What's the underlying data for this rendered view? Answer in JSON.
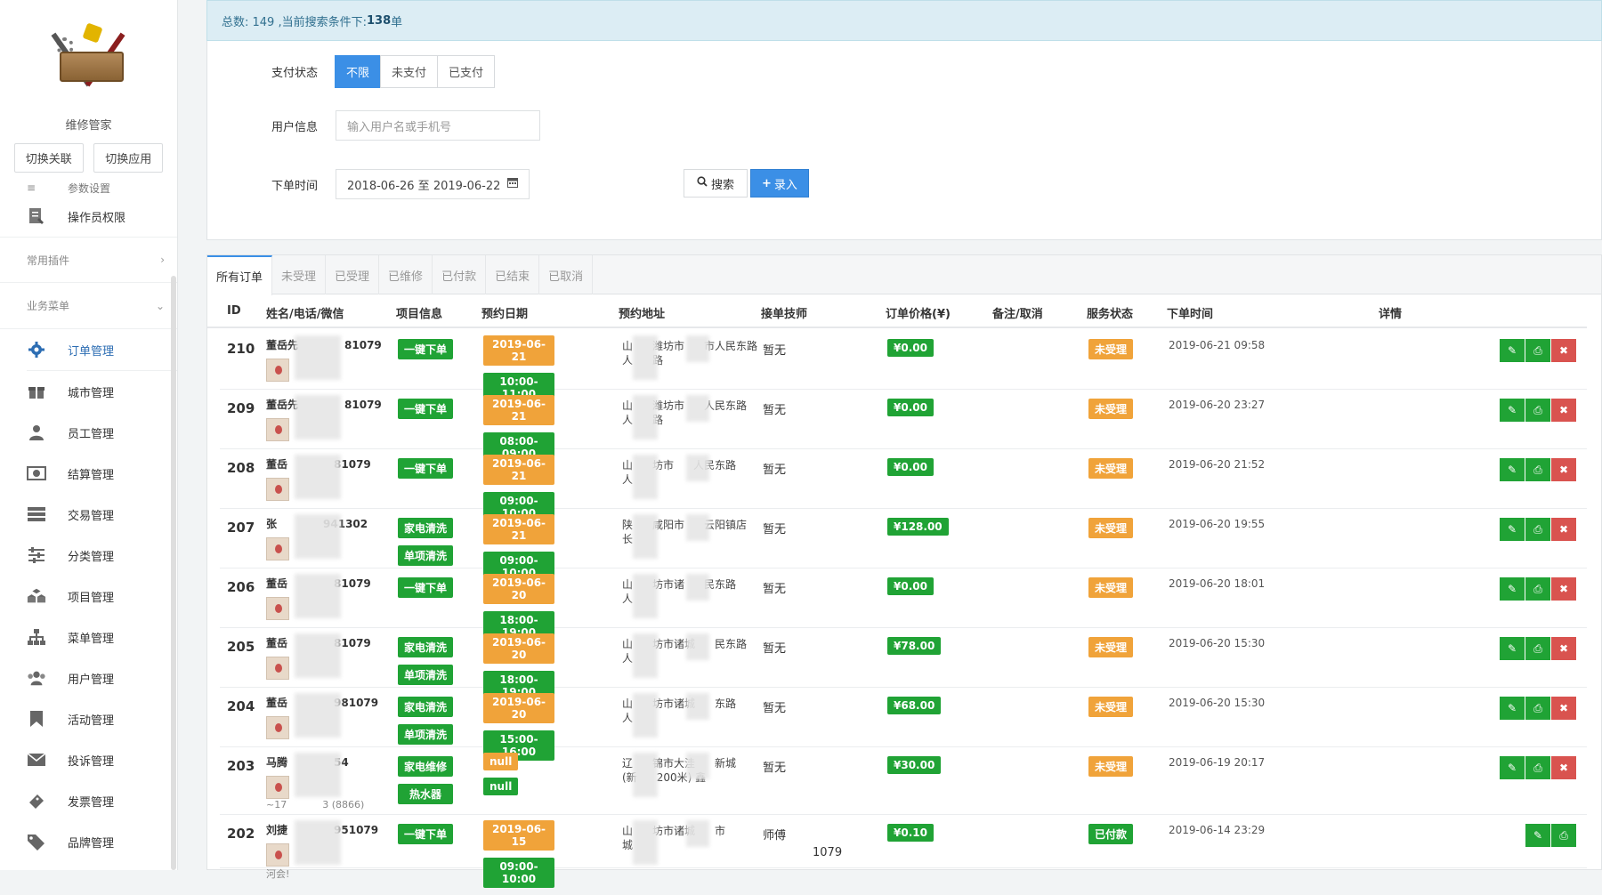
{
  "sidebar": {
    "brand": "维修管家",
    "switch_assoc": "切换关联",
    "switch_app": "切换应用",
    "cut_item": "参数设置",
    "operator": "操作员权限",
    "group_plugins": "常用插件",
    "group_business": "业务菜单",
    "menu": [
      {
        "label": "订单管理",
        "icon": "gear-icon"
      },
      {
        "label": "城市管理",
        "icon": "gift-icon"
      },
      {
        "label": "员工管理",
        "icon": "user-icon"
      },
      {
        "label": "结算管理",
        "icon": "money-icon"
      },
      {
        "label": "交易管理",
        "icon": "server-icon"
      },
      {
        "label": "分类管理",
        "icon": "sliders-icon"
      },
      {
        "label": "项目管理",
        "icon": "cubes-icon"
      },
      {
        "label": "菜单管理",
        "icon": "sitemap-icon"
      },
      {
        "label": "用户管理",
        "icon": "users-icon"
      },
      {
        "label": "活动管理",
        "icon": "bookmark-icon"
      },
      {
        "label": "投诉管理",
        "icon": "envelope-icon"
      },
      {
        "label": "发票管理",
        "icon": "ticket-icon"
      },
      {
        "label": "品牌管理",
        "icon": "tags-icon"
      }
    ]
  },
  "summary": {
    "prefix": "总数: 149 ,当前搜索条件下: ",
    "count": "138",
    "suffix": " 单"
  },
  "filters": {
    "pay_label": "支付状态",
    "pay_options": [
      "不限",
      "未支付",
      "已支付"
    ],
    "user_label": "用户信息",
    "user_placeholder": "输入用户名或手机号",
    "time_label": "下单时间",
    "time_value": "2018-06-26 至 2019-06-22",
    "search": "搜索",
    "add": "录入"
  },
  "tabs": [
    "所有订单",
    "未受理",
    "已受理",
    "已维修",
    "已付款",
    "已结束",
    "已取消"
  ],
  "columns": {
    "id": "ID",
    "name": "姓名/电话/微信",
    "project": "项目信息",
    "date": "预约日期",
    "address": "预约地址",
    "tech": "接单技师",
    "price": "订单价格(¥)",
    "note": "备注/取消",
    "status": "服务状态",
    "time": "下单时间",
    "detail": "详情"
  },
  "orders": [
    {
      "id": "210",
      "name": "董岳先",
      "phone": "81079",
      "projects": [
        "一键下单"
      ],
      "date": "2019-06-21",
      "slot": "10:00-11:00",
      "addr1": "山",
      "addr1b": "潍坊市",
      "addr1c": "市人民东路",
      "addr2": "人",
      "addr2b": "路",
      "tech": "暂无",
      "price": "¥0.00",
      "status": "未受理",
      "time": "2019-06-21 09:58",
      "show_del": true
    },
    {
      "id": "209",
      "name": "董岳先",
      "phone": "81079",
      "projects": [
        "一键下单"
      ],
      "date": "2019-06-21",
      "slot": "08:00-09:00",
      "addr1": "山",
      "addr1b": "潍坊市",
      "addr1c": "人民东路",
      "addr2": "人",
      "addr2b": "路",
      "tech": "暂无",
      "price": "¥0.00",
      "status": "未受理",
      "time": "2019-06-20 23:27",
      "show_del": true
    },
    {
      "id": "208",
      "name": "董岳",
      "phone": "81079",
      "projects": [
        "一键下单"
      ],
      "date": "2019-06-21",
      "slot": "09:00-10:00",
      "addr1": "山",
      "addr1b": "坊市",
      "addr1c": "人民东路",
      "addr2": "人",
      "addr2b": "",
      "tech": "暂无",
      "price": "¥0.00",
      "status": "未受理",
      "time": "2019-06-20 21:52",
      "show_del": true
    },
    {
      "id": "207",
      "name": "张",
      "phone": "941302",
      "projects": [
        "家电清洗",
        "单项清洗"
      ],
      "date": "2019-06-21",
      "slot": "09:00-10:00",
      "addr1": "陕",
      "addr1b": "咸阳市",
      "addr1c": "云阳镇店",
      "addr2": "长",
      "addr2b": "",
      "tech": "暂无",
      "price": "¥128.00",
      "status": "未受理",
      "time": "2019-06-20 19:55",
      "show_del": true
    },
    {
      "id": "206",
      "name": "董岳",
      "phone": "81079",
      "projects": [
        "一键下单"
      ],
      "date": "2019-06-20",
      "slot": "18:00-19:00",
      "addr1": "山",
      "addr1b": "坊市诸",
      "addr1c": "民东路",
      "addr2": "人",
      "addr2b": "",
      "tech": "暂无",
      "price": "¥0.00",
      "status": "未受理",
      "time": "2019-06-20 18:01",
      "show_del": true
    },
    {
      "id": "205",
      "name": "董岳",
      "phone": "81079",
      "projects": [
        "家电清洗",
        "单项清洗"
      ],
      "date": "2019-06-20",
      "slot": "18:00-19:00",
      "addr1": "山",
      "addr1b": "坊市诸城",
      "addr1c": "民东路",
      "addr2": "人",
      "addr2b": "",
      "tech": "暂无",
      "price": "¥78.00",
      "status": "未受理",
      "time": "2019-06-20 15:30",
      "show_del": true
    },
    {
      "id": "204",
      "name": "董岳",
      "phone": "981079",
      "projects": [
        "家电清洗",
        "单项清洗"
      ],
      "date": "2019-06-20",
      "slot": "15:00-16:00",
      "addr1": "山",
      "addr1b": "坊市诸城",
      "addr1c": "东路",
      "addr2": "人",
      "addr2b": "",
      "tech": "暂无",
      "price": "¥68.00",
      "status": "未受理",
      "time": "2019-06-20 15:30",
      "show_del": true
    },
    {
      "id": "203",
      "name": "马腾",
      "phone": "54",
      "projects": [
        "家电维修",
        "热水器"
      ],
      "date": "null",
      "slot": "null",
      "addr1": "辽",
      "addr1b": "锦市大洼",
      "addr1c": "新城",
      "addr2": "(新",
      "addr2b": "200米) 鑫",
      "tech": "暂无",
      "price": "¥30.00",
      "status": "未受理",
      "time": "2019-06-19 20:17",
      "show_del": true,
      "extra1": "~17",
      "extra2": "3 (8866)"
    },
    {
      "id": "202",
      "name": "刘捷",
      "phone": "951079",
      "projects": [
        "一键下单"
      ],
      "date": "2019-06-15",
      "slot": "09:00-10:00",
      "addr1": "山",
      "addr1b": "坊市诸城",
      "addr1c": "市",
      "addr2": "城",
      "addr2b": "",
      "tech": "师傅",
      "tech_phone": "1079",
      "price": "¥0.10",
      "status": "已付款",
      "time": "2019-06-14 23:29",
      "show_del": false,
      "extra1": "河会!"
    }
  ]
}
